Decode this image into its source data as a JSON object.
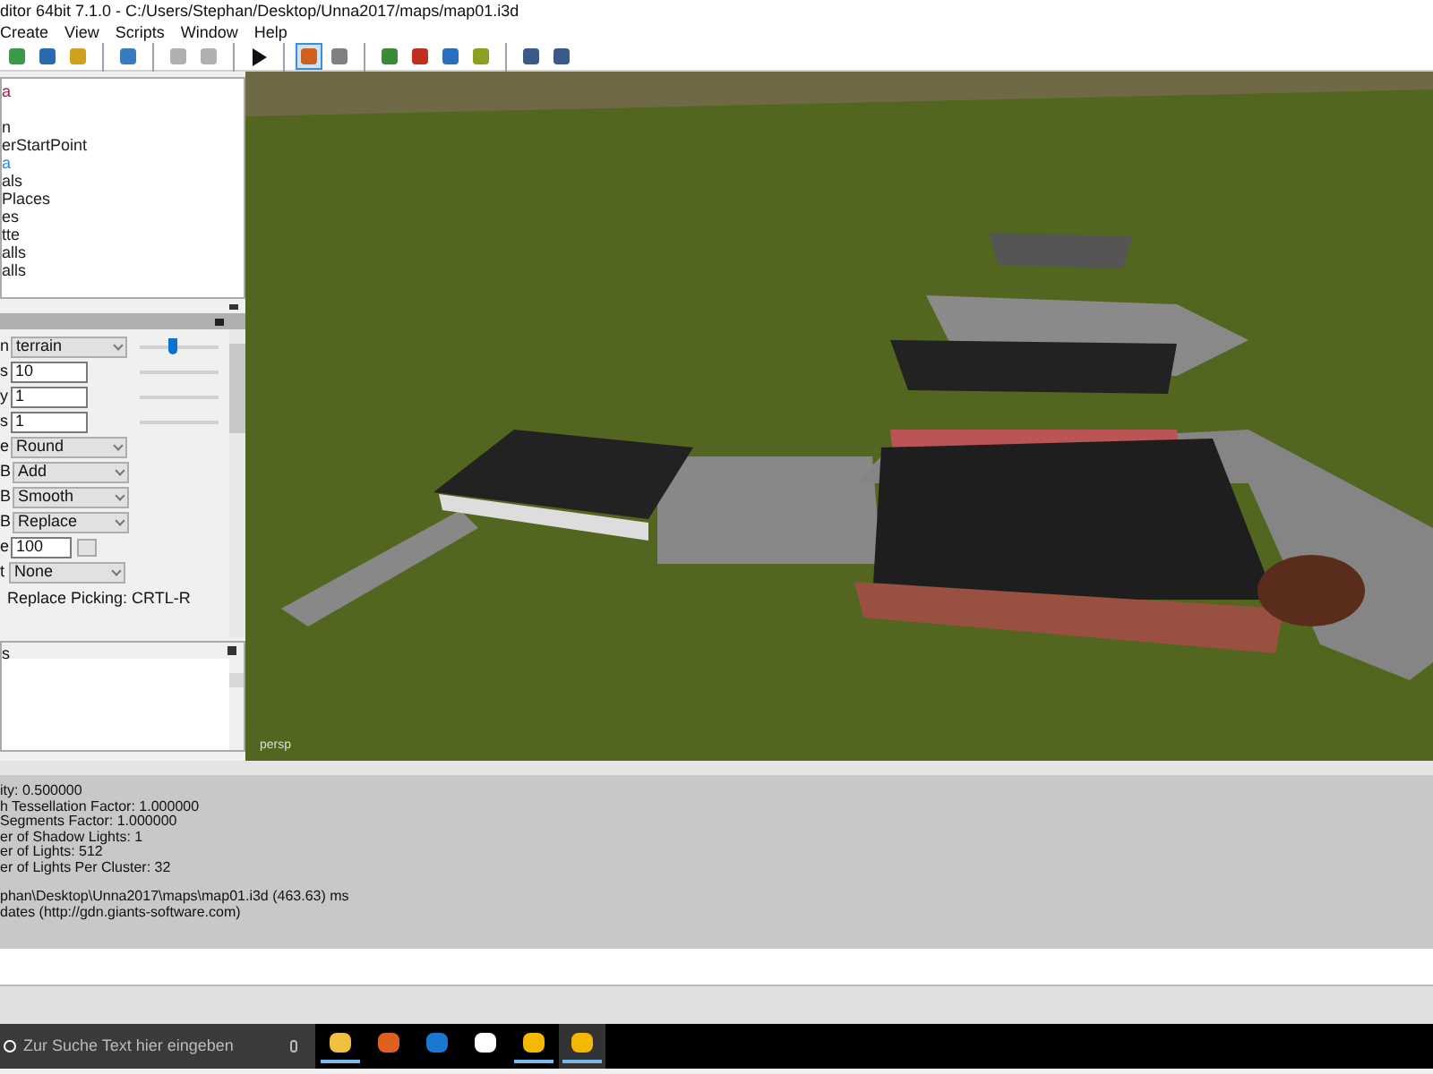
{
  "window": {
    "title": "ditor 64bit 7.1.0 - C:/Users/Stephan/Desktop/Unna2017/maps/map01.i3d"
  },
  "menu": [
    "Create",
    "View",
    "Scripts",
    "Window",
    "Help"
  ],
  "toolbar": [
    {
      "kind": "refresh"
    },
    {
      "kind": "save"
    },
    {
      "kind": "export"
    },
    {
      "kind": "sep"
    },
    {
      "kind": "import"
    },
    {
      "kind": "sep"
    },
    {
      "kind": "undo"
    },
    {
      "kind": "redo"
    },
    {
      "kind": "sep"
    },
    {
      "kind": "play"
    },
    {
      "kind": "sep"
    },
    {
      "kind": "home",
      "selected": true
    },
    {
      "kind": "magnet",
      "selected": false
    },
    {
      "kind": "sep"
    },
    {
      "kind": "terrain"
    },
    {
      "kind": "paint"
    },
    {
      "kind": "foliage"
    },
    {
      "kind": "tree"
    },
    {
      "kind": "sep"
    },
    {
      "kind": "globe"
    },
    {
      "kind": "gear"
    }
  ],
  "scenegraph": {
    "items": [
      {
        "label": "a",
        "color": "#a02040"
      },
      {
        "label": "n",
        "color": "#202020"
      },
      {
        "label": "erStartPoint",
        "color": "#202020"
      },
      {
        "label": "a",
        "color": "#2090e0"
      },
      {
        "label": "als",
        "color": "#202020"
      },
      {
        "label": "Places",
        "color": "#202020"
      },
      {
        "label": "es",
        "color": "#202020"
      },
      {
        "label": "tte",
        "color": "#202020"
      },
      {
        "label": "alls",
        "color": "#202020"
      },
      {
        "label": "alls",
        "color": "#202020"
      }
    ]
  },
  "attributes": {
    "rows": [
      {
        "label": "n",
        "kind": "select",
        "value": "terrain",
        "level": 0.4
      },
      {
        "label": "s",
        "kind": "input",
        "value": "10",
        "track": true
      },
      {
        "label": "y",
        "kind": "input",
        "value": "1",
        "track": true
      },
      {
        "label": "s",
        "kind": "input",
        "value": "1",
        "track": true
      },
      {
        "label": "e",
        "kind": "select",
        "value": "Round"
      },
      {
        "label": "B",
        "kind": "select",
        "value": "Add"
      },
      {
        "label": "B",
        "kind": "select",
        "value": "Smooth"
      },
      {
        "label": "B",
        "kind": "select",
        "value": "Replace"
      },
      {
        "label": "e",
        "kind": "spin",
        "value": "100"
      },
      {
        "label": "t",
        "kind": "select",
        "value": "None"
      }
    ],
    "hint": "Replace Picking: CRTL-R"
  },
  "bottom_panel": {
    "title": "s"
  },
  "viewport": {
    "label": "persp"
  },
  "log": [
    "ity: 0.500000",
    "h Tessellation Factor: 1.000000",
    "Segments Factor: 1.000000",
    "er of Shadow Lights: 1",
    "er of Lights: 512",
    "er of Lights Per Cluster: 32",
    "phan\\Desktop\\Unna2017\\maps\\map01.i3d (463.63) ms",
    "dates (http://gdn.giants-software.com)"
  ],
  "taskbar": {
    "search_placeholder": "Zur Suche Text hier eingeben",
    "apps": [
      {
        "kind": "folder",
        "running": true
      },
      {
        "kind": "firefox",
        "running": false
      },
      {
        "kind": "edge",
        "running": false
      },
      {
        "kind": "mail",
        "running": false
      },
      {
        "kind": "editor",
        "running": true
      },
      {
        "kind": "editor",
        "running": true,
        "selected": true
      }
    ]
  }
}
